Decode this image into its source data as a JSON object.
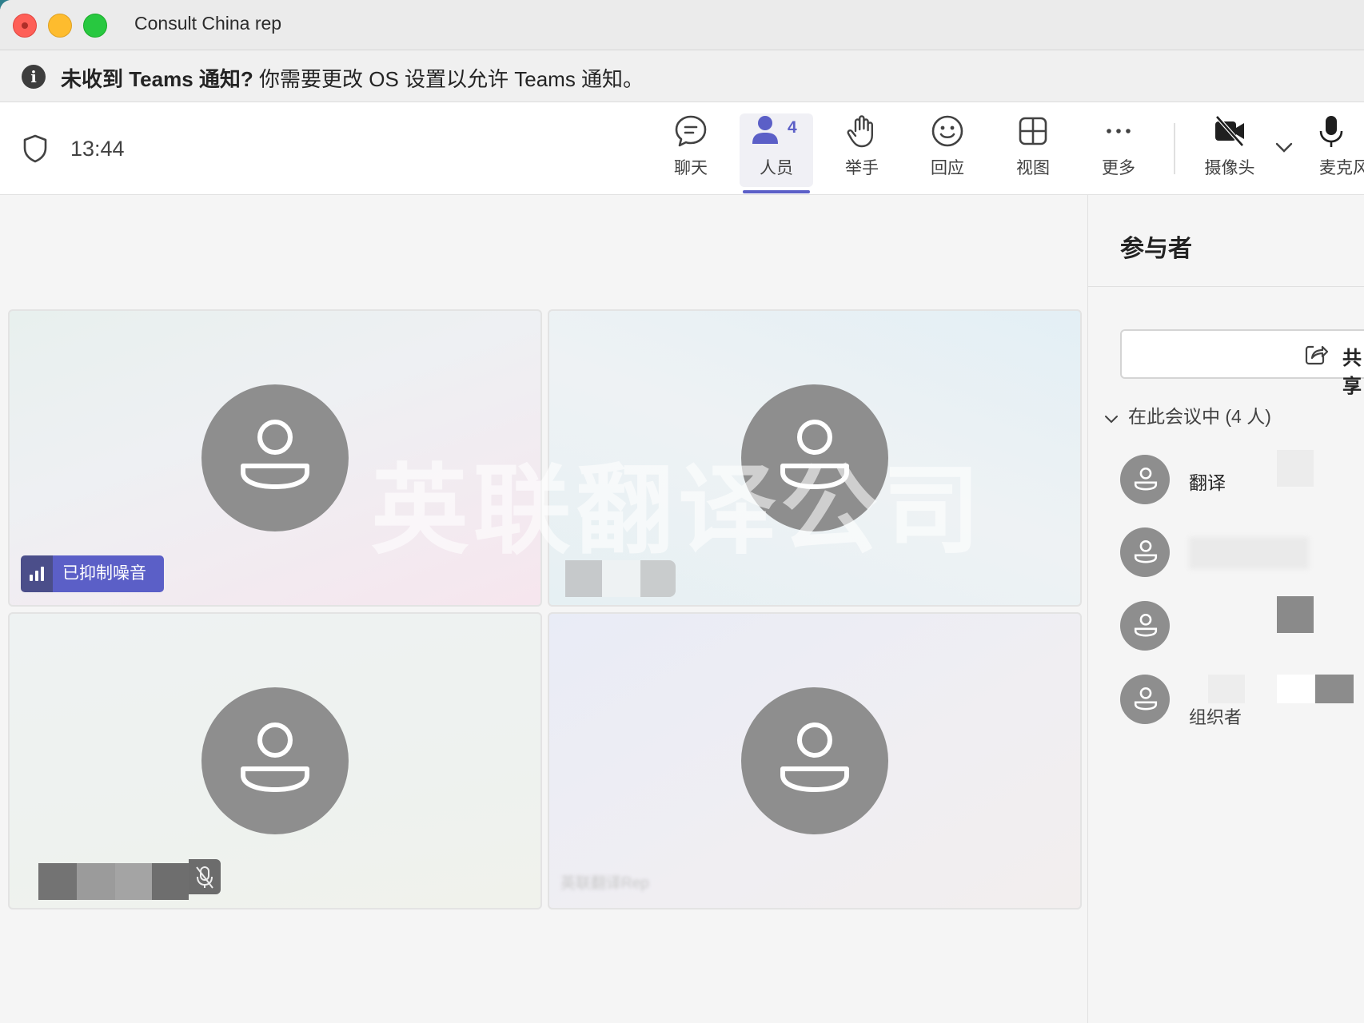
{
  "window": {
    "title": "Consult China rep"
  },
  "notification": {
    "icon": "info-icon",
    "bold_text": "未收到 Teams 通知?",
    "text": " 你需要更改 OS 设置以允许 Teams 通知。"
  },
  "toolbar": {
    "timer": "13:44",
    "chat_label": "聊天",
    "people_label": "人员",
    "people_count": "4",
    "raise_hand_label": "举手",
    "react_label": "回应",
    "view_label": "视图",
    "more_label": "更多",
    "camera_label": "摄像头",
    "mic_label": "麦克风",
    "accent_color": "#5b5fc7"
  },
  "stage": {
    "noise_badge": "已抑制噪音",
    "tile4_name": "英联翻译Rep"
  },
  "watermark": "英联翻译公司",
  "panel": {
    "title": "参与者",
    "share_label": "共享",
    "section": "在此会议中 (4 人)",
    "participants": [
      {
        "name": "翻译"
      },
      {
        "name": ""
      },
      {
        "name": ""
      },
      {
        "name": "",
        "role": "组织者"
      }
    ]
  }
}
